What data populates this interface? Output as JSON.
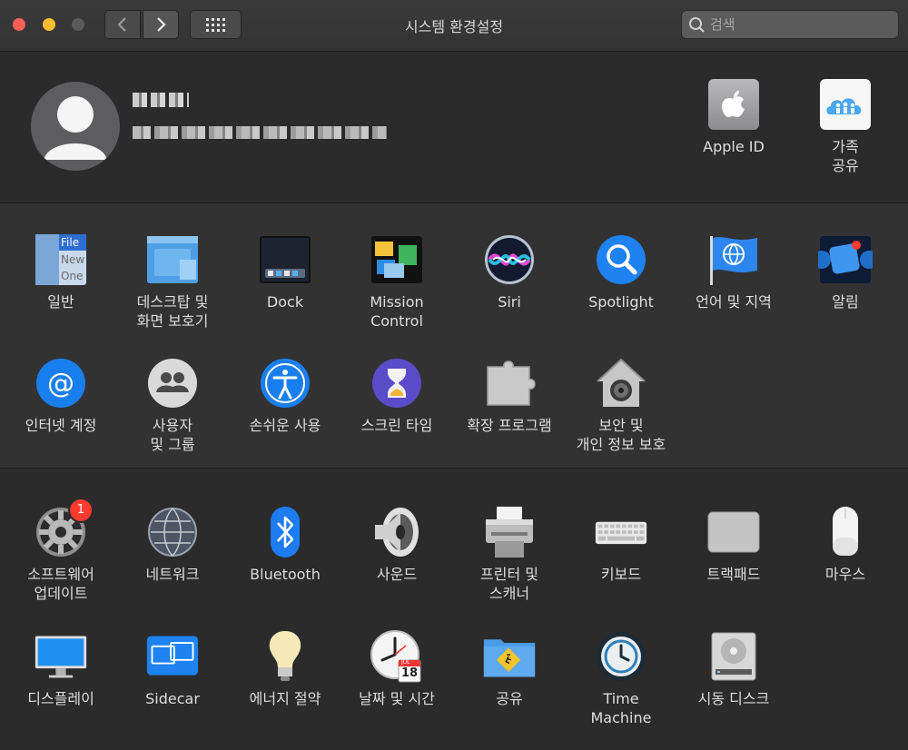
{
  "window": {
    "title": "시스템 환경설정",
    "search_placeholder": "검색"
  },
  "account": {
    "apple_id_label": "Apple ID",
    "family_label": "가족\n공유"
  },
  "panes_row1": [
    {
      "label": "일반"
    },
    {
      "label": "데스크탑 및\n화면 보호기"
    },
    {
      "label": "Dock"
    },
    {
      "label": "Mission\nControl"
    },
    {
      "label": "Siri"
    },
    {
      "label": "Spotlight"
    },
    {
      "label": "언어 및 지역"
    },
    {
      "label": "알림"
    }
  ],
  "panes_row2": [
    {
      "label": "인터넷 계정"
    },
    {
      "label": "사용자\n및 그룹"
    },
    {
      "label": "손쉬운 사용"
    },
    {
      "label": "스크린 타임"
    },
    {
      "label": "확장 프로그램"
    },
    {
      "label": "보안 및\n개인 정보 보호"
    }
  ],
  "panes_row3": [
    {
      "label": "소프트웨어\n업데이트",
      "badge": "1"
    },
    {
      "label": "네트워크"
    },
    {
      "label": "Bluetooth"
    },
    {
      "label": "사운드"
    },
    {
      "label": "프린터 및\n스캐너"
    },
    {
      "label": "키보드"
    },
    {
      "label": "트랙패드"
    },
    {
      "label": "마우스"
    }
  ],
  "panes_row4": [
    {
      "label": "디스플레이"
    },
    {
      "label": "Sidecar"
    },
    {
      "label": "에너지 절약"
    },
    {
      "label": "날짜 및 시간",
      "calendar_month": "JUL",
      "calendar_day": "18"
    },
    {
      "label": "공유"
    },
    {
      "label": "Time\nMachine"
    },
    {
      "label": "시동 디스크"
    }
  ],
  "colors": {
    "accent_blue": "#1e7cf2",
    "badge_red": "#ff3b30"
  }
}
